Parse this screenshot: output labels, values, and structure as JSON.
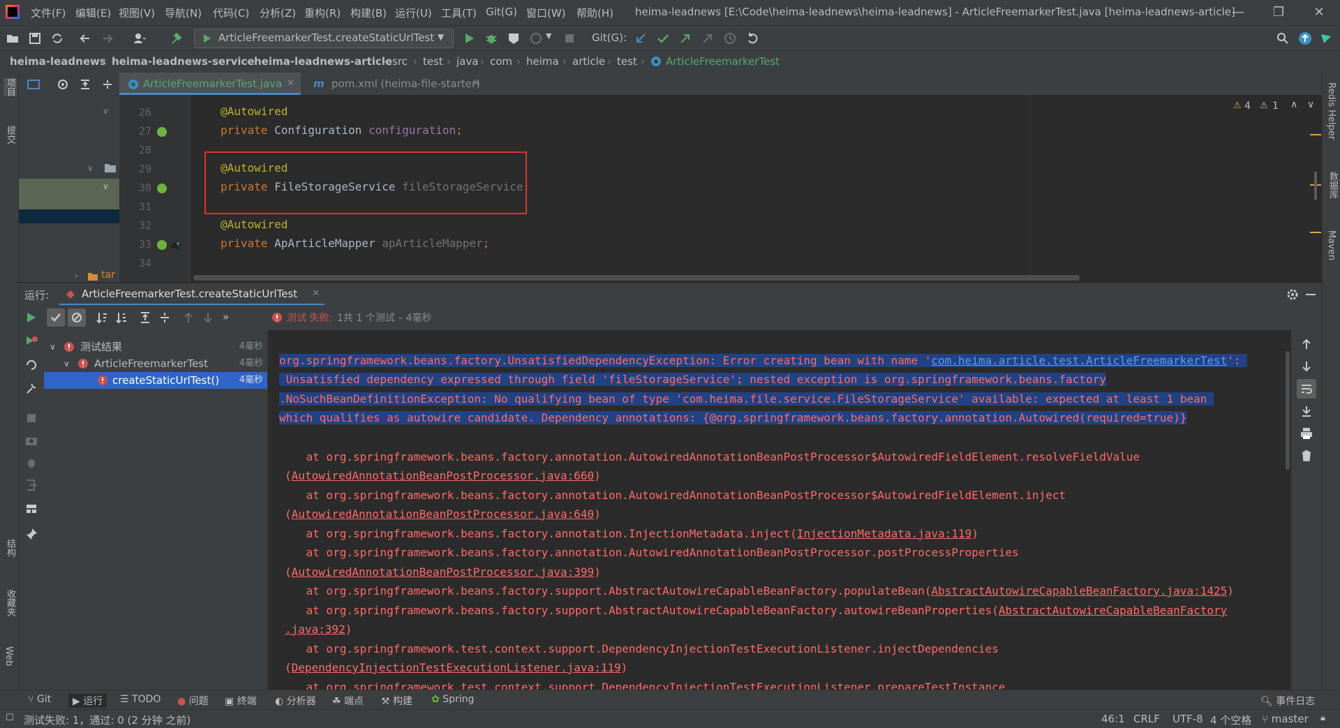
{
  "window": {
    "title": "heima-leadnews [E:\\Code\\heima-leadnews\\heima-leadnews] - ArticleFreemarkerTest.java [heima-leadnews-article]",
    "menu": [
      "文件(F)",
      "编辑(E)",
      "视图(V)",
      "导航(N)",
      "代码(C)",
      "分析(Z)",
      "重构(R)",
      "构建(B)",
      "运行(U)",
      "工具(T)",
      "Git(G)",
      "窗口(W)",
      "帮助(H)"
    ]
  },
  "toolbar": {
    "run_config": "ArticleFreemarkerTest.createStaticUrlTest",
    "git_label": "Git(G):"
  },
  "breadcrumbs": [
    "heima-leadnews",
    "heima-leadnews-service",
    "heima-leadnews-article",
    "src",
    "test",
    "java",
    "com",
    "heima",
    "article",
    "test",
    "ArticleFreemarkerTest"
  ],
  "left_stripe": [
    "项目",
    "提交",
    "结构",
    "收藏夹",
    "Web"
  ],
  "right_stripe": [
    "Redis Helper",
    "数据库",
    "Maven"
  ],
  "project_panel": {
    "partial_label": "tar"
  },
  "editor_tabs": [
    {
      "label": "ArticleFreemarkerTest.java",
      "active": true
    },
    {
      "label": "pom.xml (heima-file-starter)",
      "active": false
    }
  ],
  "editor": {
    "warnings": {
      "error_count": "4",
      "warning_count": "1"
    },
    "lines": [
      {
        "num": "26",
        "annotation": "@Autowired",
        "type": "",
        "field": ""
      },
      {
        "num": "27",
        "annotation": "",
        "type": "Configuration",
        "field": "configuration"
      },
      {
        "num": "28",
        "annotation": "",
        "type": "",
        "field": ""
      },
      {
        "num": "29",
        "annotation": "@Autowired",
        "type": "",
        "field": ""
      },
      {
        "num": "30",
        "annotation": "",
        "type": "FileStorageService",
        "field": "fileStorageService"
      },
      {
        "num": "31",
        "annotation": "",
        "type": "",
        "field": ""
      },
      {
        "num": "32",
        "annotation": "@Autowired",
        "type": "",
        "field": ""
      },
      {
        "num": "33",
        "annotation": "",
        "type": "ApArticleMapper",
        "field": "apArticleMapper"
      },
      {
        "num": "34",
        "annotation": "",
        "type": "",
        "field": ""
      }
    ],
    "keyword_private": "private"
  },
  "run_panel": {
    "label": "运行:",
    "tab": "ArticleFreemarkerTest.createStaticUrlTest",
    "status_prefix": "测试 失败:",
    "status_detail": "1共 1 个测试 – 4毫秒",
    "tree": [
      {
        "label": "测试结果",
        "time": "4毫秒",
        "level": 0
      },
      {
        "label": "ArticleFreemarkerTest",
        "time": "4毫秒",
        "level": 1
      },
      {
        "label": "createStaticUrlTest()",
        "time": "4毫秒",
        "level": 2
      }
    ],
    "console": {
      "error_l1_pre": "org.springframework.beans.factory.UnsatisfiedDependencyException: Error creating bean with name '",
      "error_l1_link": "com.heima.article.test.ArticleFreemarkerTest",
      "error_l1_post": "':",
      "error_l2": " Unsatisfied dependency expressed through field 'fileStorageService'; nested exception is org.springframework.beans.factory",
      "error_l3": ".NoSuchBeanDefinitionException: No qualifying bean of type 'com.heima.file.service.FileStorageService' available: expected at least 1 bean ",
      "error_l4": "which qualifies as autowire candidate. Dependency annotations: {@org.springframework.beans.factory.annotation.Autowired(required=true)}",
      "trace": [
        {
          "text": "    at org.springframework.beans.factory.annotation.AutowiredAnnotationBeanPostProcessor$AutowiredFieldElement.resolveFieldValue",
          "pre": "",
          "link": "",
          "post": ""
        },
        {
          "text": "",
          "pre": "(",
          "link": "AutowiredAnnotationBeanPostProcessor.java:660",
          "post": ")"
        },
        {
          "text": "    at org.springframework.beans.factory.annotation.AutowiredAnnotationBeanPostProcessor$AutowiredFieldElement.inject",
          "pre": "",
          "link": "",
          "post": ""
        },
        {
          "text": "",
          "pre": "(",
          "link": "AutowiredAnnotationBeanPostProcessor.java:640",
          "post": ")"
        },
        {
          "text": "",
          "pre": "    at org.springframework.beans.factory.annotation.InjectionMetadata.inject(",
          "link": "InjectionMetadata.java:119",
          "post": ")"
        },
        {
          "text": "    at org.springframework.beans.factory.annotation.AutowiredAnnotationBeanPostProcessor.postProcessProperties",
          "pre": "",
          "link": "",
          "post": ""
        },
        {
          "text": "",
          "pre": "(",
          "link": "AutowiredAnnotationBeanPostProcessor.java:399",
          "post": ")"
        },
        {
          "text": "",
          "pre": "    at org.springframework.beans.factory.support.AbstractAutowireCapableBeanFactory.populateBean(",
          "link": "AbstractAutowireCapableBeanFactory.java:1425",
          "post": ")"
        },
        {
          "text": "",
          "pre": "    at org.springframework.beans.factory.support.AbstractAutowireCapableBeanFactory.autowireBeanProperties(",
          "link": "AbstractAutowireCapableBeanFactory",
          "post": ""
        },
        {
          "text": "",
          "pre": "",
          "link": ".java:392",
          "post": ")"
        },
        {
          "text": "    at org.springframework.test.context.support.DependencyInjectionTestExecutionListener.injectDependencies",
          "pre": "",
          "link": "",
          "post": ""
        },
        {
          "text": "",
          "pre": "(",
          "link": "DependencyInjectionTestExecutionListener.java:119",
          "post": ")"
        },
        {
          "text": "    at org.springframework.test.context.support.DependencyInjectionTestExecutionListener.prepareTestInstance",
          "pre": "",
          "link": "",
          "post": ""
        }
      ]
    }
  },
  "bottom_bar": {
    "tools": [
      "Git",
      "运行",
      "TODO",
      "问题",
      "终端",
      "分析器",
      "端点",
      "构建",
      "Spring"
    ],
    "event_log": "事件日志"
  },
  "status_bar": {
    "message": "测试失败: 1，通过: 0 (2 分钟 之前)",
    "position": "46:1",
    "line_sep": "CRLF",
    "encoding": "UTF-8",
    "indent": "4 个空格",
    "branch": "master"
  },
  "colors": {
    "background": "#2b2b2b",
    "panel": "#3c3f41",
    "error_text": "#ff6b68",
    "selection": "#214283",
    "annotation": "#bbb529",
    "keyword": "#cc7832",
    "field": "#9876aa",
    "highlight_box": "#e0312d",
    "accent": "#4a88c7"
  }
}
